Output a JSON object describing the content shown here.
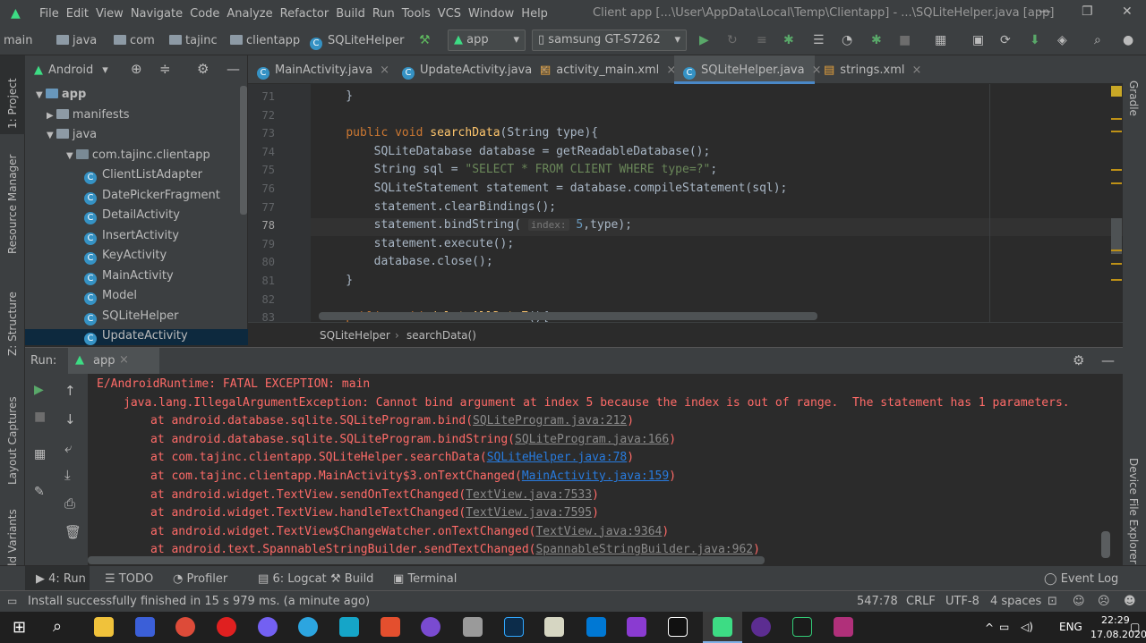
{
  "menu": {
    "items": [
      "File",
      "Edit",
      "View",
      "Navigate",
      "Code",
      "Analyze",
      "Refactor",
      "Build",
      "Run",
      "Tools",
      "VCS",
      "Window",
      "Help"
    ],
    "window_title": "Client app [...\\User\\AppData\\Local\\Temp\\Clientapp] - ...\\SQLiteHelper.java [app]"
  },
  "nav": {
    "breadcrumb": [
      "main",
      "java",
      "com",
      "tajinc",
      "clientapp",
      "SQLiteHelper"
    ],
    "run_config": "app",
    "device": "samsung GT-S7262"
  },
  "project": {
    "view_label": "Android",
    "tree": [
      {
        "label": "app",
        "kind": "module",
        "level": 0
      },
      {
        "label": "manifests",
        "kind": "folder",
        "level": 1
      },
      {
        "label": "java",
        "kind": "folder",
        "level": 1
      },
      {
        "label": "com.tajinc.clientapp",
        "kind": "package",
        "level": 2
      },
      {
        "label": "ClientListAdapter",
        "kind": "class",
        "level": 3
      },
      {
        "label": "DatePickerFragment",
        "kind": "class",
        "level": 3
      },
      {
        "label": "DetailActivity",
        "kind": "class",
        "level": 3
      },
      {
        "label": "InsertActivity",
        "kind": "class",
        "level": 3
      },
      {
        "label": "KeyActivity",
        "kind": "class",
        "level": 3
      },
      {
        "label": "MainActivity",
        "kind": "class",
        "level": 3
      },
      {
        "label": "Model",
        "kind": "class",
        "level": 3
      },
      {
        "label": "SQLiteHelper",
        "kind": "class",
        "level": 3
      },
      {
        "label": "UpdateActivity",
        "kind": "class",
        "level": 3
      }
    ]
  },
  "side_tools": {
    "left": [
      "1: Project",
      "Resource Manager",
      "Z: Structure",
      "Layout Captures",
      "Build Variants"
    ],
    "right": [
      "Gradle",
      "Device File Explorer"
    ]
  },
  "tabs": [
    {
      "label": "MainActivity.java",
      "active": false
    },
    {
      "label": "UpdateActivity.java",
      "active": false
    },
    {
      "label": "activity_main.xml",
      "active": false
    },
    {
      "label": "SQLiteHelper.java",
      "active": true
    },
    {
      "label": "strings.xml",
      "active": false
    }
  ],
  "editor": {
    "lines": [
      {
        "n": "71",
        "text": "    }"
      },
      {
        "n": "72",
        "text": ""
      },
      {
        "n": "73",
        "text": "    public void searchData(String type){"
      },
      {
        "n": "74",
        "text": "        SQLiteDatabase database = getReadableDatabase();"
      },
      {
        "n": "75",
        "text": "        String sql = \"SELECT * FROM CLIENT WHERE type=?\";"
      },
      {
        "n": "76",
        "text": "        SQLiteStatement statement = database.compileStatement(sql);"
      },
      {
        "n": "77",
        "text": "        statement.clearBindings();"
      },
      {
        "n": "78",
        "text": "        statement.bindString( index: 5,type);"
      },
      {
        "n": "79",
        "text": "        statement.execute();"
      },
      {
        "n": "80",
        "text": "        database.close();"
      },
      {
        "n": "81",
        "text": "    }"
      },
      {
        "n": "82",
        "text": ""
      },
      {
        "n": "83",
        "text": "    public void deleteAllDataZ(){"
      }
    ],
    "hint_label": "index:",
    "breadcrumb": [
      "SQLiteHelper",
      "searchData()"
    ]
  },
  "run": {
    "title": "Run:",
    "config": "app",
    "lines": [
      {
        "t": "E/AndroidRuntime: FATAL EXCEPTION: main",
        "indent": 0
      },
      {
        "t": "java.lang.IllegalArgumentException: Cannot bind argument at index 5 because the index is out of range.  The statement has 1 parameters.",
        "indent": 1
      },
      {
        "t": "at android.database.sqlite.SQLiteProgram.bind(",
        "link": "SQLiteProgram.java:212",
        "tail": ")",
        "indent": 2,
        "linkColor": "gray"
      },
      {
        "t": "at android.database.sqlite.SQLiteProgram.bindString(",
        "link": "SQLiteProgram.java:166",
        "tail": ")",
        "indent": 2,
        "linkColor": "gray"
      },
      {
        "t": "at com.tajinc.clientapp.SQLiteHelper.searchData(",
        "link": "SQLiteHelper.java:78",
        "tail": ")",
        "indent": 2,
        "linkColor": "blue"
      },
      {
        "t": "at com.tajinc.clientapp.MainActivity$3.onTextChanged(",
        "link": "MainActivity.java:159",
        "tail": ")",
        "indent": 2,
        "linkColor": "blue"
      },
      {
        "t": "at android.widget.TextView.sendOnTextChanged(",
        "link": "TextView.java:7533",
        "tail": ")",
        "indent": 2,
        "linkColor": "gray"
      },
      {
        "t": "at android.widget.TextView.handleTextChanged(",
        "link": "TextView.java:7595",
        "tail": ")",
        "indent": 2,
        "linkColor": "gray"
      },
      {
        "t": "at android.widget.TextView$ChangeWatcher.onTextChanged(",
        "link": "TextView.java:9364",
        "tail": ")",
        "indent": 2,
        "linkColor": "gray"
      },
      {
        "t": "at android.text.SpannableStringBuilder.sendTextChanged(",
        "link": "SpannableStringBuilder.java:962",
        "tail": ")",
        "indent": 2,
        "linkColor": "gray"
      }
    ]
  },
  "bottom_tools": [
    "4: Run",
    "TODO",
    "Profiler",
    "6: Logcat",
    "Build",
    "Terminal",
    "Event Log"
  ],
  "status": {
    "message": "Install successfully finished in 15 s 979 ms. (a minute ago)",
    "position": "547:78",
    "line_sep": "CRLF",
    "encoding": "UTF-8",
    "indent": "4 spaces"
  },
  "taskbar": {
    "lang": "ENG",
    "time": "22:29",
    "date": "17.08.2020"
  },
  "colors": {
    "accent": "#3ddc84",
    "error": "#ff6b68",
    "link": "#287bde",
    "keyword": "#cc7832"
  }
}
